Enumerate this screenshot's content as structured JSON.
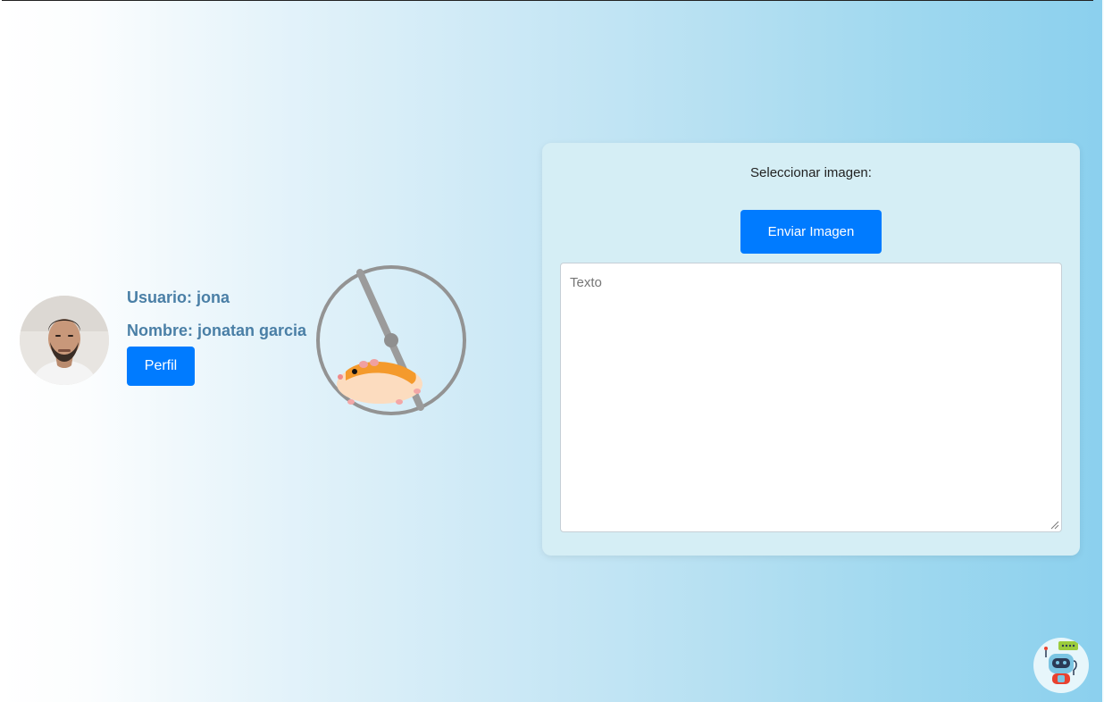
{
  "user": {
    "username_line": "Usuario: jona",
    "name_line": "Nombre: jonatan garcia",
    "profile_button_label": "Perfil",
    "avatar_icon": "user-photo"
  },
  "loader": {
    "icon": "hamster-wheel-icon"
  },
  "upload_card": {
    "label": "Seleccionar imagen:",
    "send_button_label": "Enviar Imagen",
    "textarea_placeholder": "Texto",
    "textarea_value": ""
  },
  "chatbot": {
    "icon": "robot-chat-icon"
  },
  "colors": {
    "primary_button": "#007bff",
    "user_text": "#4a7fa6",
    "card_background": "#d5eef5",
    "gradient_start": "#ffffff",
    "gradient_end": "#8bd0ee"
  }
}
